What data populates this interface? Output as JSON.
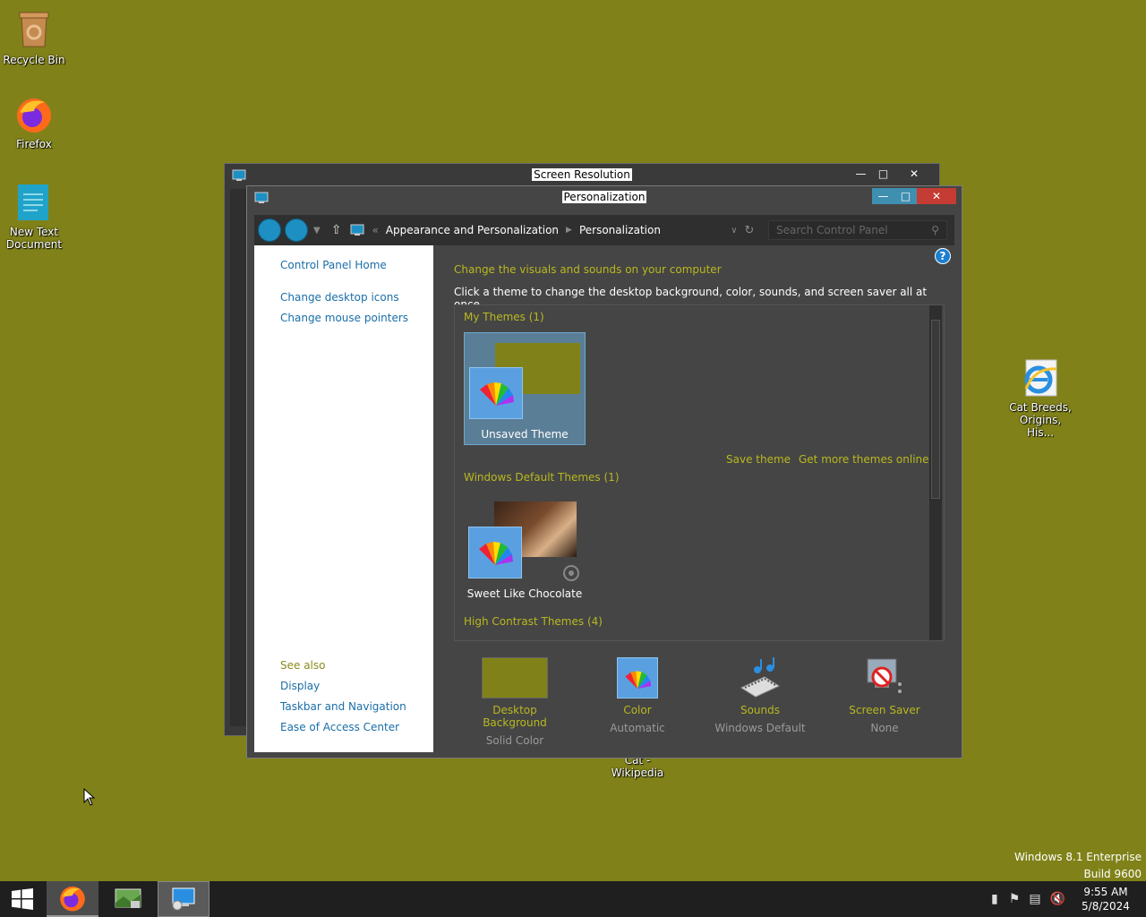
{
  "desktop": {
    "icons": [
      {
        "label": "Recycle Bin"
      },
      {
        "label": "Firefox"
      },
      {
        "label": "New Text Document"
      },
      {
        "label": "Cat Breeds, Origins, His..."
      },
      {
        "label": "Cat - Wikipedia"
      }
    ],
    "watermark_line1": "Windows 8.1 Enterprise",
    "watermark_line2": "Build 9600"
  },
  "back_window": {
    "title": "Screen Resolution"
  },
  "window": {
    "title": "Personalization",
    "breadcrumb": [
      "Appearance and Personalization",
      "Personalization"
    ],
    "breadcrumb_prefix": "«",
    "search_placeholder": "Search Control Panel",
    "left_links": [
      "Control Panel Home",
      "Change desktop icons",
      "Change mouse pointers"
    ],
    "see_also_label": "See also",
    "see_also_links": [
      "Display",
      "Taskbar and Navigation",
      "Ease of Access Center"
    ],
    "headline": "Change the visuals and sounds on your computer",
    "subline": "Click a theme to change the desktop background, color, sounds, and screen saver all at once.",
    "groups": {
      "my_themes": "My Themes (1)",
      "default_themes": "Windows Default Themes (1)",
      "high_contrast": "High Contrast Themes (4)"
    },
    "themes": {
      "unsaved": "Unsaved Theme",
      "sweet": "Sweet Like Chocolate"
    },
    "save_theme": "Save theme",
    "get_more": "Get more themes online",
    "bottom": [
      {
        "name": "Desktop Background",
        "value": "Solid Color"
      },
      {
        "name": "Color",
        "value": "Automatic"
      },
      {
        "name": "Sounds",
        "value": "Windows Default"
      },
      {
        "name": "Screen Saver",
        "value": "None"
      }
    ],
    "help": "?"
  },
  "taskbar": {
    "time": "9:55 AM",
    "date": "5/8/2024"
  },
  "colors": {
    "desktop": "#808219",
    "accent": "#1d8fc2",
    "link_yellow": "#b8b820"
  }
}
